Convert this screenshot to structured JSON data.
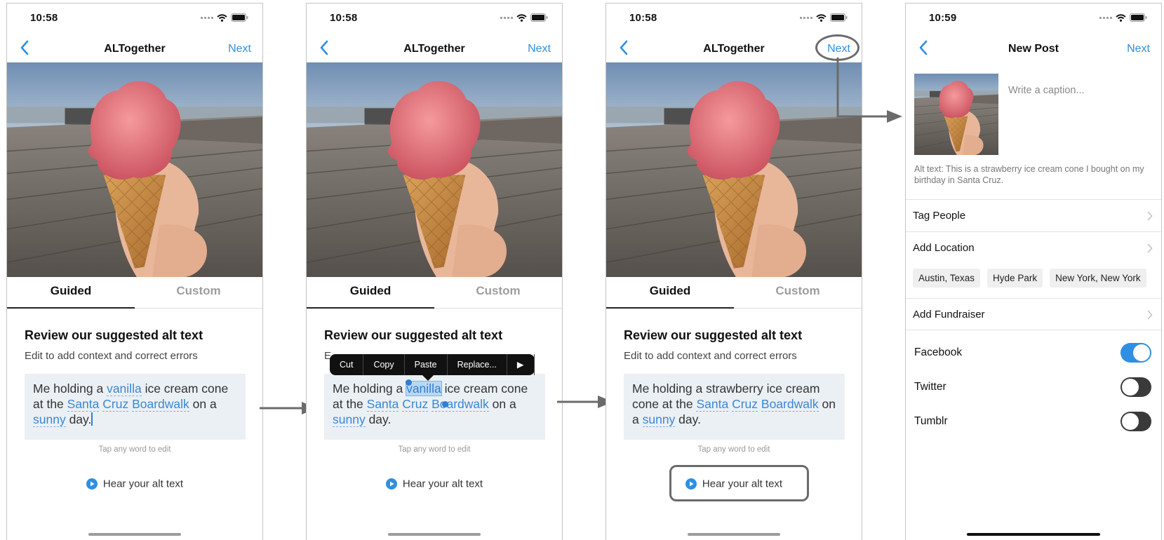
{
  "screens": [
    {
      "time": "10:58",
      "nav_title": "ALTogether",
      "nav_next": "Next",
      "tab_guided": "Guided",
      "tab_custom": "Custom",
      "heading": "Review our suggested alt text",
      "subheading": "Edit to add context and correct errors",
      "alt_text": {
        "p1": "Me holding a ",
        "w1": "vanilla",
        "p2": " ice cream cone at the ",
        "w2": "Santa",
        "w3": "Cruz",
        "w4": "Boardwalk",
        "p3": " on a ",
        "w5": "sunny",
        "p4": " day."
      },
      "hint": "Tap any word to edit",
      "hear_label": "Hear your alt text"
    },
    {
      "time": "10:58",
      "nav_title": "ALTogether",
      "nav_next": "Next",
      "tab_guided": "Guided",
      "tab_custom": "Custom",
      "heading": "Review our suggested alt text",
      "subheading_visible_fragment": "E",
      "context_menu": [
        "Cut",
        "Copy",
        "Paste",
        "Replace..."
      ],
      "alt_text": {
        "p1": "Me holding a ",
        "w1": "vanilla",
        "p2": " ice cream cone at the ",
        "w2": "Santa",
        "w3": "Cruz",
        "w4": "Boardwalk",
        "p3": " on a ",
        "w5": "sunny",
        "p4": " day."
      },
      "hint": "Tap any word to edit",
      "hear_label": "Hear your alt text"
    },
    {
      "time": "10:58",
      "nav_title": "ALTogether",
      "nav_next": "Next",
      "tab_guided": "Guided",
      "tab_custom": "Custom",
      "heading": "Review our suggested alt text",
      "subheading": "Edit to add context and correct errors",
      "alt_text": {
        "p1": "Me holding a strawberry ice cream cone at the ",
        "w2": "Santa",
        "w3": "Cruz",
        "w4": "Boardwalk",
        "p3": " on a ",
        "w5": "sunny",
        "p4": " day."
      },
      "hint": "Tap any word to edit",
      "hear_label": "Hear your alt text"
    },
    {
      "time": "10:59",
      "nav_title": "New Post",
      "nav_next": "Next",
      "caption_placeholder": "Write a caption...",
      "alt_text_preview": "Alt text: This is a strawberry ice cream cone I bought on my birthday in Santa Cruz.",
      "tag_people": "Tag People",
      "add_location": "Add Location",
      "location_chips": [
        "Austin, Texas",
        "Hyde Park",
        "New York, New York"
      ],
      "add_fundraiser": "Add Fundraiser",
      "share": [
        {
          "label": "Facebook",
          "on": true
        },
        {
          "label": "Twitter",
          "on": false
        },
        {
          "label": "Tumblr",
          "on": false
        }
      ]
    }
  ],
  "colors": {
    "accent": "#2f8fe3",
    "annotation": "#6b6b6b"
  },
  "icons": {
    "back": "chevron-left-icon",
    "play": "play-circle-icon",
    "row": "chevron-right-icon"
  }
}
